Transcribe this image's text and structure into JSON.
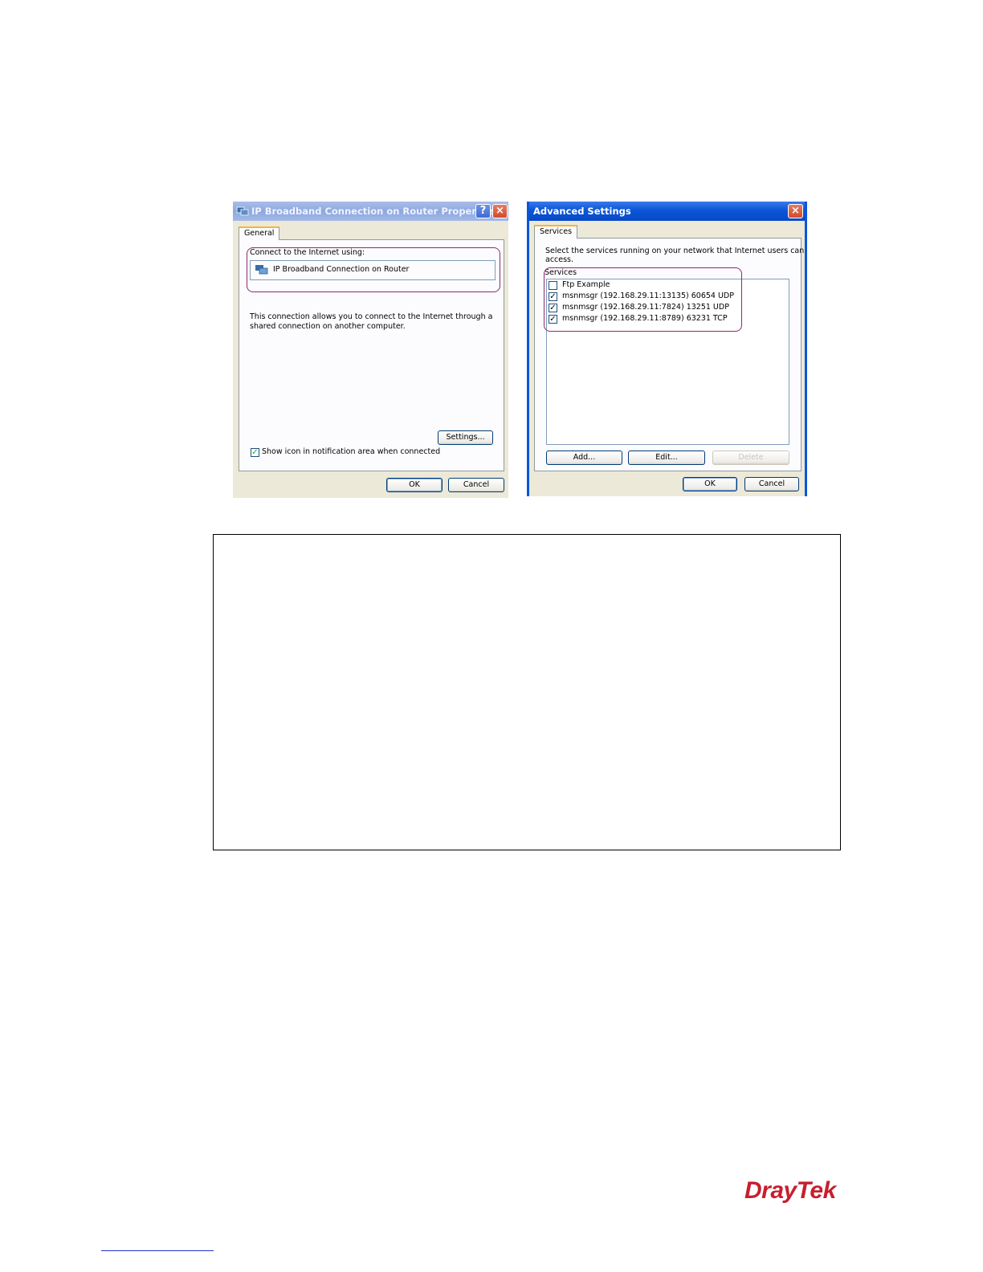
{
  "dialog1": {
    "title": "IP Broadband Connection on Router Properties",
    "help": "?",
    "close": "×",
    "tab": "General",
    "connect_label": "Connect to the Internet using:",
    "connection_name": "IP Broadband Connection on Router",
    "description_line1": "This connection allows you to connect to the Internet through a",
    "description_line2": "shared connection on another computer.",
    "settings_button": "Settings...",
    "show_icon_label": "Show icon in notification area when connected",
    "show_icon_checked": true,
    "ok": "OK",
    "cancel": "Cancel"
  },
  "dialog2": {
    "title": "Advanced Settings",
    "close": "×",
    "tab": "Services",
    "instructions_line1": "Select the services running on your network that Internet users can",
    "instructions_line2": "access.",
    "services_group": "Services",
    "services": [
      {
        "label": "Ftp Example",
        "checked": false
      },
      {
        "label": "msnmsgr (192.168.29.11:13135) 60654 UDP",
        "checked": true
      },
      {
        "label": "msnmsgr (192.168.29.11:7824) 13251 UDP",
        "checked": true
      },
      {
        "label": "msnmsgr (192.168.29.11:8789) 63231 TCP",
        "checked": true
      }
    ],
    "add": "Add...",
    "edit": "Edit...",
    "delete": "Delete",
    "ok": "OK",
    "cancel": "Cancel"
  },
  "check_mark": "✓",
  "brand": {
    "name_a": "Dray",
    "name_b": "Tek",
    "color": "#c81e2f"
  }
}
